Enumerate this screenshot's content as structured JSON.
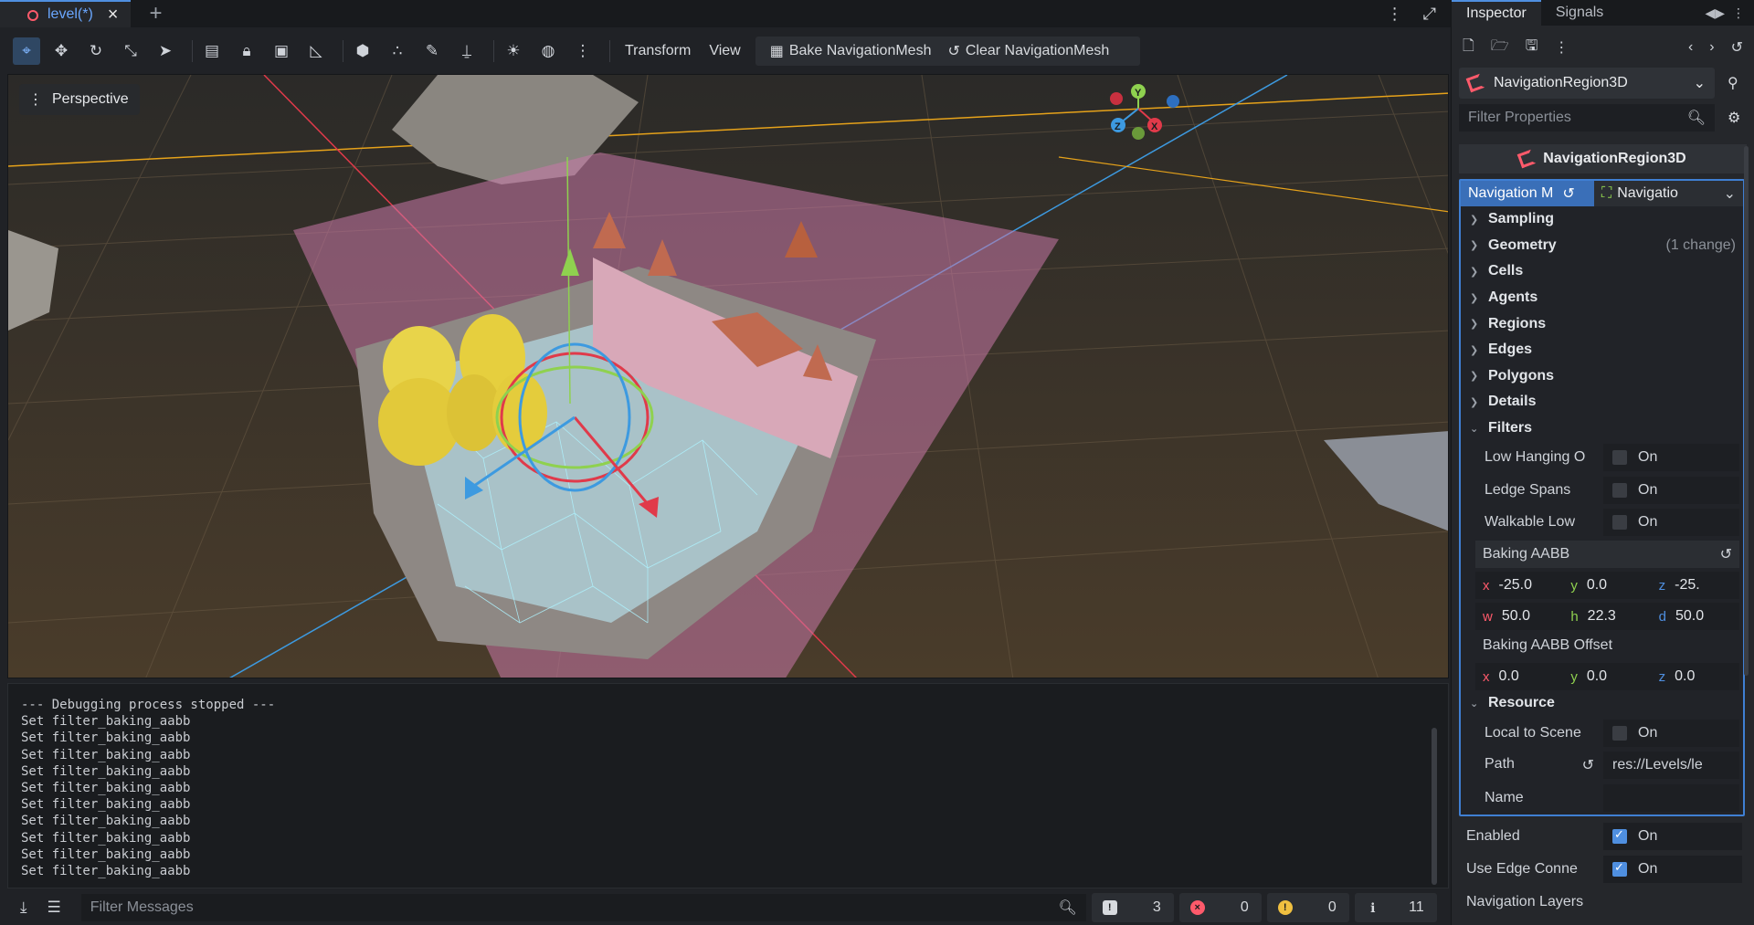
{
  "scene_tabs": {
    "active_tab": "level(*)",
    "add_symbol": "+"
  },
  "toolbar": {
    "transform_label": "Transform",
    "view_label": "View",
    "bake_label": "Bake NavigationMesh",
    "clear_label": "Clear NavigationMesh"
  },
  "viewport": {
    "perspective_label": "Perspective",
    "gizmo_axes": [
      "Y",
      "Z",
      "X"
    ]
  },
  "output": {
    "log_lines": [
      "--- Debugging process stopped ---",
      "Set filter_baking_aabb",
      "Set filter_baking_aabb",
      "Set filter_baking_aabb",
      "Set filter_baking_aabb",
      "Set filter_baking_aabb",
      "Set filter_baking_aabb",
      "Set filter_baking_aabb",
      "Set filter_baking_aabb",
      "Set filter_baking_aabb",
      "Set filter_baking_aabb"
    ],
    "filter_placeholder": "Filter Messages",
    "counts": {
      "errors_all": "3",
      "errors": "0",
      "warnings": "0",
      "info": "11"
    }
  },
  "inspector": {
    "tabs": [
      "Inspector",
      "Signals"
    ],
    "node_name": "NavigationRegion3D",
    "filter_placeholder": "Filter Properties",
    "header_title": "NavigationRegion3D",
    "navmesh_label": "Navigation M",
    "navmesh_resource": "Navigatio",
    "sections": {
      "sampling": "Sampling",
      "geometry": "Geometry",
      "geometry_note": "(1 change)",
      "cells": "Cells",
      "agents": "Agents",
      "regions": "Regions",
      "edges": "Edges",
      "polygons": "Polygons",
      "details": "Details",
      "filters": "Filters",
      "resource": "Resource"
    },
    "filters": {
      "low_hanging": "Low Hanging O",
      "ledge_spans": "Ledge Spans",
      "walkable_low": "Walkable Low",
      "on_label": "On"
    },
    "baking_aabb": {
      "label": "Baking AABB",
      "x": "-25.0",
      "y": "0.0",
      "z": "-25.",
      "w": "50.0",
      "h": "22.3",
      "d": "50.0"
    },
    "baking_aabb_offset": {
      "label": "Baking AABB Offset",
      "x": "0.0",
      "y": "0.0",
      "z": "0.0"
    },
    "resource": {
      "local_to_scene": "Local to Scene",
      "path_label": "Path",
      "path_value": "res://Levels/le",
      "name_label": "Name"
    },
    "outer": {
      "enabled": "Enabled",
      "use_edge": "Use Edge Conne",
      "nav_layers": "Navigation Layers",
      "on_label": "On"
    }
  },
  "colors": {
    "accent": "#4f8fe0",
    "axis_x": "#ff5a6b",
    "axis_y": "#8fd14f",
    "axis_z": "#4f8fe0",
    "navmesh_tint": "#c878a8"
  }
}
